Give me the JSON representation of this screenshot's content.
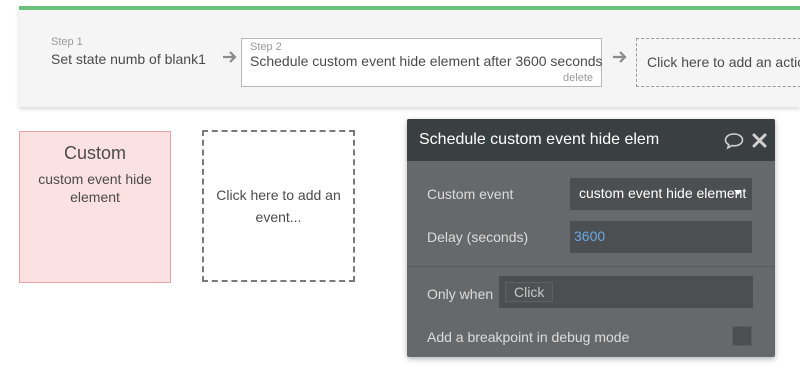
{
  "workflow": {
    "steps": [
      {
        "number": "Step 1",
        "text": "Set state numb of blank1"
      },
      {
        "number": "Step 2",
        "text": "Schedule custom event hide element after 3600 seconds",
        "delete_label": "delete"
      }
    ],
    "add_action_label": "Click here to add an action..."
  },
  "event_canvas": {
    "custom_event": {
      "title": "Custom",
      "subtitle": "custom event hide element"
    },
    "add_event_label": "Click here to add an event..."
  },
  "modal": {
    "title": "Schedule custom event hide elem",
    "custom_event_label": "Custom event",
    "custom_event_value": "custom event hide element",
    "delay_label": "Delay (seconds)",
    "delay_value": "3600",
    "only_when_label": "Only when",
    "only_when_value": "Click",
    "breakpoint_label": "Add a breakpoint in debug mode"
  },
  "icons": [
    "arrow-right-icon",
    "comment-icon",
    "close-icon",
    "dropdown-caret-icon"
  ],
  "colors": {
    "accent_green": "#6cc17a",
    "custom_event_bg": "#fbe1e2",
    "modal_header": "#3a3f41",
    "modal_body": "#65696c",
    "delay_value": "#6aa8e0"
  }
}
